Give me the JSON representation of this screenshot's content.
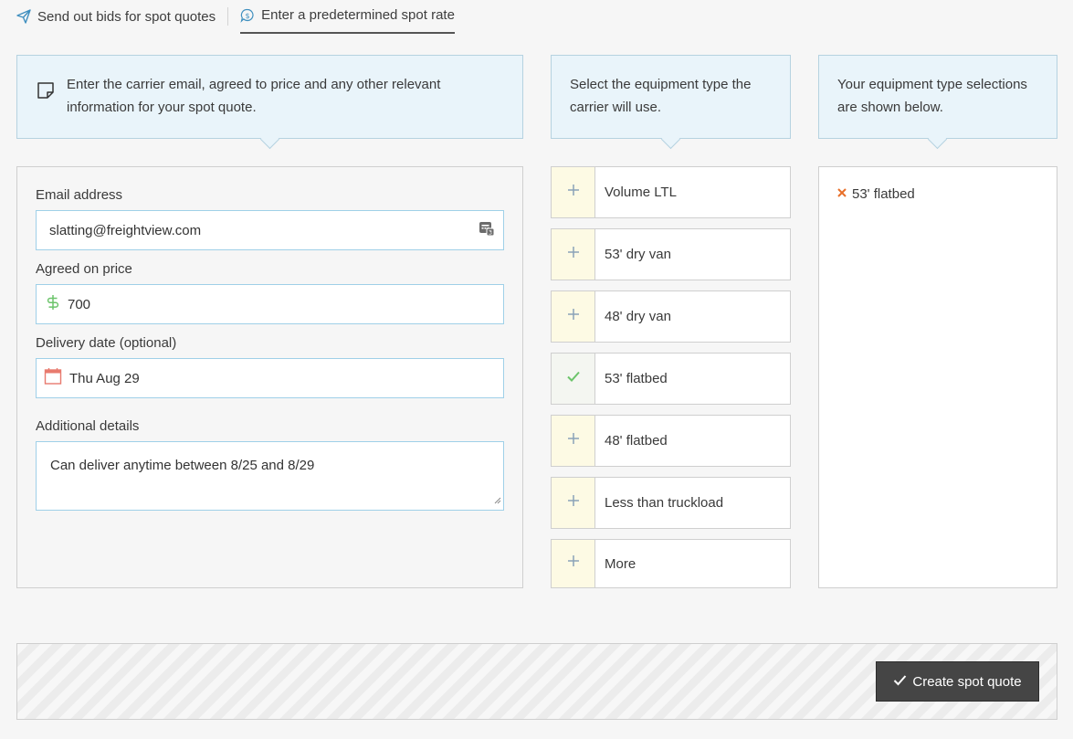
{
  "tabs": [
    {
      "label": "Send out bids for spot quotes",
      "icon": "paper-plane-icon",
      "active": false
    },
    {
      "label": "Enter a predetermined spot rate",
      "icon": "dollar-bubble-icon",
      "active": true
    }
  ],
  "info": {
    "form": "Enter the carrier email, agreed to price and any other relevant information for your spot quote.",
    "equipment": "Select the equipment type the carrier will use.",
    "selections": "Your equipment type selections are shown below."
  },
  "form": {
    "email_label": "Email address",
    "email_value": "slatting@freightview.com",
    "price_label": "Agreed on price",
    "price_value": "700",
    "date_label": "Delivery date (optional)",
    "date_value": "Thu Aug 29",
    "details_label": "Additional details",
    "details_value": "Can deliver anytime between 8/25 and 8/29"
  },
  "equipment": [
    {
      "label": "Volume LTL",
      "selected": false
    },
    {
      "label": "53' dry van",
      "selected": false
    },
    {
      "label": "48' dry van",
      "selected": false
    },
    {
      "label": "53' flatbed",
      "selected": true
    },
    {
      "label": "48' flatbed",
      "selected": false
    },
    {
      "label": "Less than truckload",
      "selected": false
    },
    {
      "label": "More",
      "selected": false
    }
  ],
  "selections": [
    {
      "label": "53' flatbed"
    }
  ],
  "actions": {
    "create_label": "Create spot quote"
  },
  "colors": {
    "info_bg": "#e9f4fa",
    "field_border": "#9fd0e8",
    "plus_box": "#fdfae4",
    "check": "#6cc46b",
    "remove_x": "#e8702a",
    "button_bg": "#454545"
  }
}
